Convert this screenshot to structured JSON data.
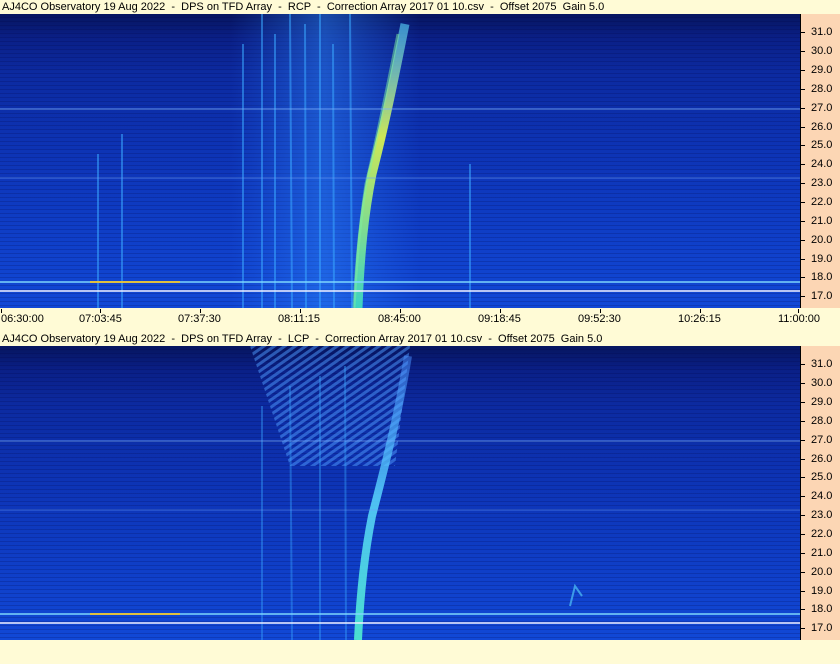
{
  "panels": [
    {
      "id": "rcp",
      "title": "AJ4CO Observatory 19 Aug 2022  -  DPS on TFD Array  -  RCP  -  Correction Array 2017 01 10.csv  -  Offset 2075  Gain 5.0",
      "freq_ticks": [
        "31.0",
        "30.0",
        "29.0",
        "28.0",
        "27.0",
        "26.0",
        "25.0",
        "24.0",
        "23.0",
        "22.0",
        "21.0",
        "20.0",
        "19.0",
        "18.0",
        "17.0"
      ]
    },
    {
      "id": "lcp",
      "title": "AJ4CO Observatory 19 Aug 2022  -  DPS on TFD Array  -  LCP  -  Correction Array 2017 01 10.csv  -  Offset 2075  Gain 5.0",
      "freq_ticks": [
        "31.0",
        "30.0",
        "29.0",
        "28.0",
        "27.0",
        "26.0",
        "25.0",
        "24.0",
        "23.0",
        "22.0",
        "21.0",
        "20.0",
        "19.0",
        "18.0",
        "17.0"
      ]
    }
  ],
  "time_axis": {
    "labels": [
      "06:30:00",
      "07:03:45",
      "07:37:30",
      "08:11:15",
      "08:45:00",
      "09:18:45",
      "09:52:30",
      "10:26:15",
      "11:00:00"
    ]
  },
  "colors": {
    "background": "#fffbd6",
    "axis_panel": "#fcd6b4",
    "spectrum_low": "#0a1f86",
    "spectrum_high": "#f0f040",
    "burst": "#6cf0b0"
  }
}
